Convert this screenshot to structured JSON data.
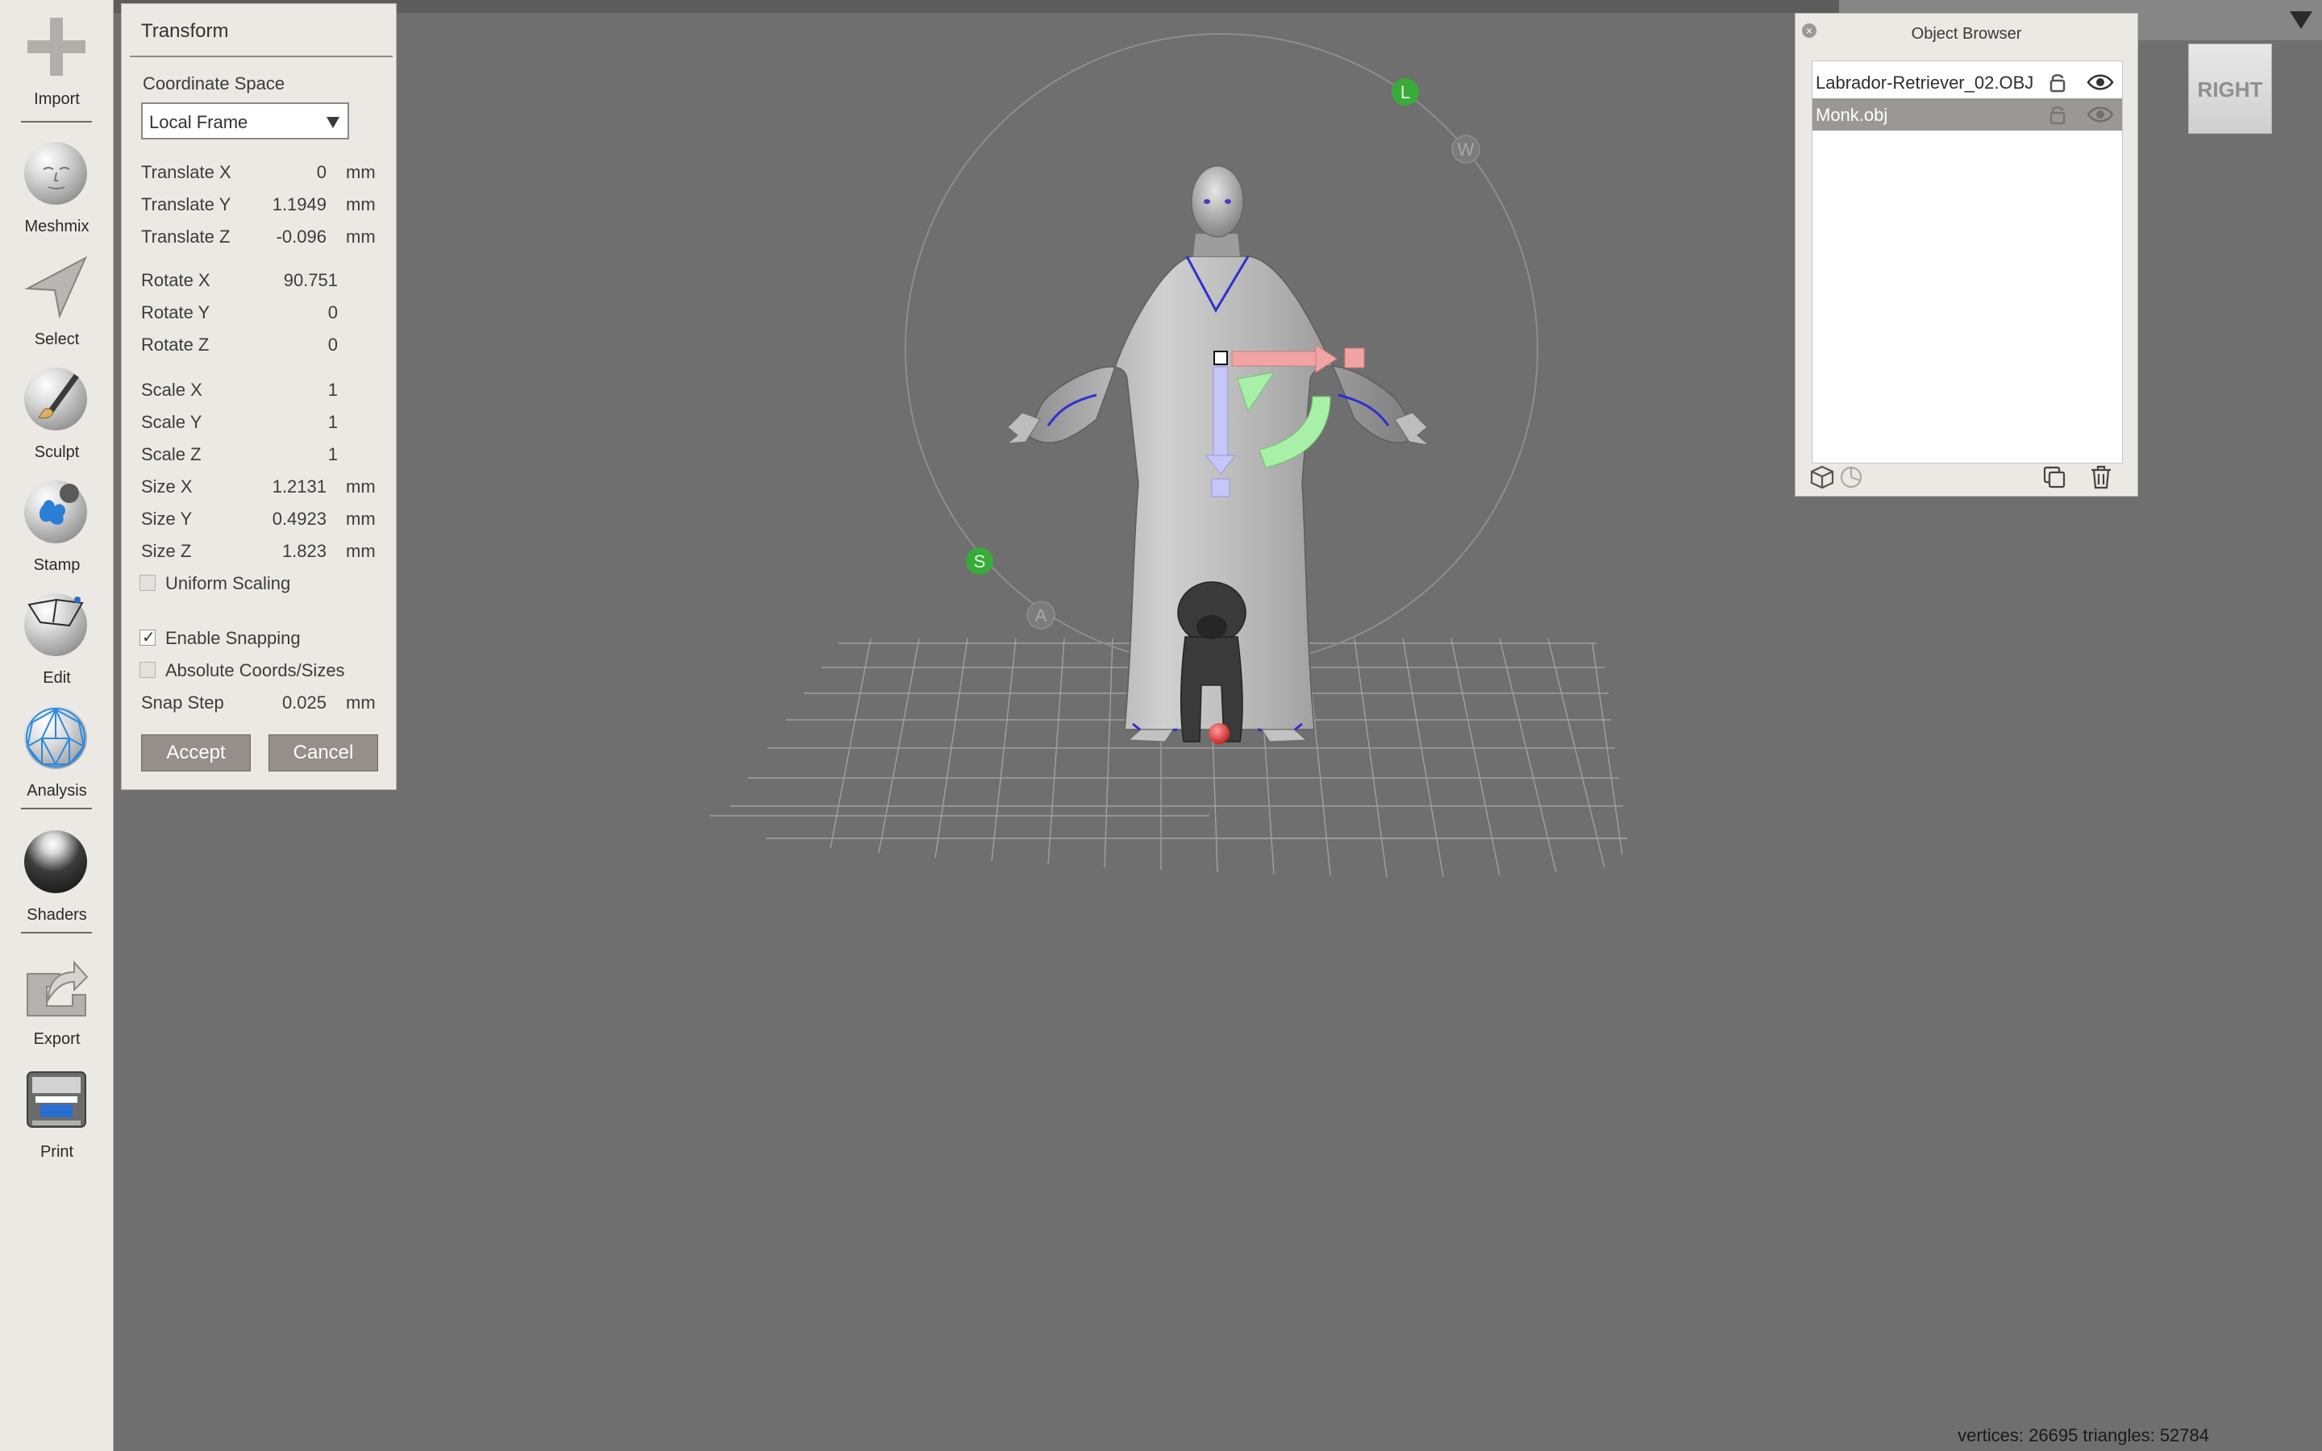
{
  "toolbar": {
    "items": [
      {
        "label": "Import",
        "icon": "plus-icon"
      },
      {
        "label": "Meshmix",
        "icon": "meshmix-head-icon"
      },
      {
        "label": "Select",
        "icon": "arrow-cursor-icon"
      },
      {
        "label": "Sculpt",
        "icon": "brush-sphere-icon"
      },
      {
        "label": "Stamp",
        "icon": "stamp-sphere-icon"
      },
      {
        "label": "Edit",
        "icon": "edit-sphere-icon"
      },
      {
        "label": "Analysis",
        "icon": "mesh-sphere-icon"
      },
      {
        "label": "Shaders",
        "icon": "chrome-sphere-icon"
      },
      {
        "label": "Export",
        "icon": "export-icon"
      },
      {
        "label": "Print",
        "icon": "printer-icon"
      }
    ]
  },
  "transform": {
    "title": "Transform",
    "coord_space_label": "Coordinate Space",
    "coord_space_value": "Local Frame",
    "fields": {
      "tx": {
        "label": "Translate X",
        "value": "0",
        "unit": "mm"
      },
      "ty": {
        "label": "Translate Y",
        "value": "1.1949",
        "unit": "mm"
      },
      "tz": {
        "label": "Translate Z",
        "value": "-0.096",
        "unit": "mm"
      },
      "rx": {
        "label": "Rotate X",
        "value": "90.751"
      },
      "ry": {
        "label": "Rotate Y",
        "value": "0"
      },
      "rz": {
        "label": "Rotate Z",
        "value": "0"
      },
      "sx": {
        "label": "Scale X",
        "value": "1"
      },
      "sy": {
        "label": "Scale Y",
        "value": "1"
      },
      "sz": {
        "label": "Scale Z",
        "value": "1"
      },
      "szx": {
        "label": "Size X",
        "value": "1.2131",
        "unit": "mm"
      },
      "szy": {
        "label": "Size Y",
        "value": "0.4923",
        "unit": "mm"
      },
      "szz": {
        "label": "Size Z",
        "value": "1.823",
        "unit": "mm"
      },
      "snap": {
        "label": "Snap Step",
        "value": "0.025",
        "unit": "mm"
      }
    },
    "uniform_scaling": {
      "label": "Uniform Scaling",
      "checked": false
    },
    "enable_snapping": {
      "label": "Enable Snapping",
      "checked": true
    },
    "absolute_coords": {
      "label": "Absolute Coords/Sizes",
      "checked": false
    },
    "accept_label": "Accept",
    "cancel_label": "Cancel"
  },
  "object_browser": {
    "title": "Object Browser",
    "close_glyph": "×",
    "objects": [
      {
        "name": "Labrador-Retriever_02.OBJ",
        "selected": false
      },
      {
        "name": "Monk.obj",
        "selected": true
      }
    ]
  },
  "view_cube": {
    "face_label": "RIGHT"
  },
  "gizmo_labels": {
    "l": "L",
    "w": "W",
    "s": "S",
    "a": "A"
  },
  "status": {
    "text": "vertices: 26695 triangles: 52784"
  },
  "colors": {
    "background": "#6f6f6f",
    "panel": "#ece9e5",
    "button": "#968e8b",
    "gizmo_x": "#f4a8a8",
    "gizmo_y": "#a8f0a8",
    "gizmo_z": "#c4c4f8",
    "handle_green": "#3aaa3a",
    "pivot_red": "#e03030"
  }
}
